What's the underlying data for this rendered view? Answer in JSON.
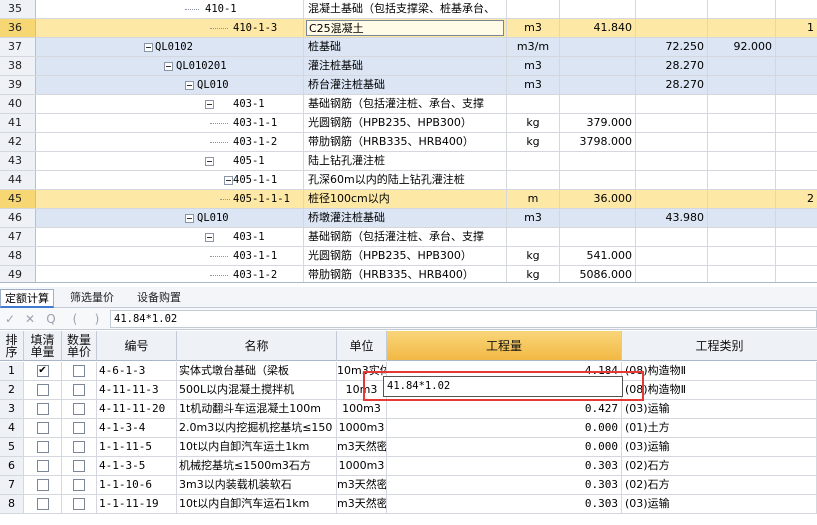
{
  "top_rows": [
    {
      "num": "35",
      "code": "410-1",
      "name": "混凝土基础（包括支撑梁、桩基承台、",
      "unit": "",
      "qty": "",
      "p1": "",
      "p2": "",
      "p3": "",
      "style": ""
    },
    {
      "num": "36",
      "code": "410-1-3",
      "name": "C25混凝土",
      "unit": "m3",
      "qty": "41.840",
      "p1": "",
      "p2": "",
      "p3": "1",
      "style": "hl"
    },
    {
      "num": "37",
      "code": "QL0102",
      "name": "桩基础",
      "unit": "m3/m",
      "qty": "",
      "p1": "72.250",
      "p2": "92.000",
      "p3": "",
      "style": "blue"
    },
    {
      "num": "38",
      "code": "QL010201",
      "name": "灌注桩基础",
      "unit": "m3",
      "qty": "",
      "p1": "28.270",
      "p2": "",
      "p3": "",
      "style": "blue"
    },
    {
      "num": "39",
      "code": "QL010",
      "name": "桥台灌注桩基础",
      "unit": "m3",
      "qty": "",
      "p1": "28.270",
      "p2": "",
      "p3": "",
      "style": "blue"
    },
    {
      "num": "40",
      "code": "403-1",
      "name": "基础钢筋（包括灌注桩、承台、支撑",
      "unit": "",
      "qty": "",
      "p1": "",
      "p2": "",
      "p3": "",
      "style": ""
    },
    {
      "num": "41",
      "code": "403-1-1",
      "name": "光圆钢筋（HPB235、HPB300）",
      "unit": "kg",
      "qty": "379.000",
      "p1": "",
      "p2": "",
      "p3": "",
      "style": ""
    },
    {
      "num": "42",
      "code": "403-1-2",
      "name": "带肋钢筋（HRB335、HRB400）",
      "unit": "kg",
      "qty": "3798.000",
      "p1": "",
      "p2": "",
      "p3": "",
      "style": ""
    },
    {
      "num": "43",
      "code": "405-1",
      "name": "陆上钻孔灌注桩",
      "unit": "",
      "qty": "",
      "p1": "",
      "p2": "",
      "p3": "",
      "style": ""
    },
    {
      "num": "44",
      "code": "405-1-1",
      "name": "孔深60m以内的陆上钻孔灌注桩",
      "unit": "",
      "qty": "",
      "p1": "",
      "p2": "",
      "p3": "",
      "style": ""
    },
    {
      "num": "45",
      "code": "405-1-1-1",
      "name": "桩径100cm以内",
      "unit": "m",
      "qty": "36.000",
      "p1": "",
      "p2": "",
      "p3": "2",
      "style": "hl"
    },
    {
      "num": "46",
      "code": "QL010",
      "name": "桥墩灌注桩基础",
      "unit": "m3",
      "qty": "",
      "p1": "43.980",
      "p2": "",
      "p3": "",
      "style": "blue"
    },
    {
      "num": "47",
      "code": "403-1",
      "name": "基础钢筋（包括灌注桩、承台、支撑",
      "unit": "",
      "qty": "",
      "p1": "",
      "p2": "",
      "p3": "",
      "style": ""
    },
    {
      "num": "48",
      "code": "403-1-1",
      "name": "光圆钢筋（HPB235、HPB300）",
      "unit": "kg",
      "qty": "541.000",
      "p1": "",
      "p2": "",
      "p3": "",
      "style": ""
    },
    {
      "num": "49",
      "code": "403-1-2",
      "name": "带肋钢筋（HRB335、HRB400）",
      "unit": "kg",
      "qty": "5086.000",
      "p1": "",
      "p2": "",
      "p3": "",
      "style": ""
    }
  ],
  "tabs": [
    "定额计算",
    "筛选量价",
    "设备购置"
  ],
  "formula": {
    "icons": [
      "✓",
      "✕",
      "Q",
      "(",
      ")"
    ],
    "value": "41.84*1.02"
  },
  "bottom_headers": {
    "num": "排序",
    "fill_price": "填清单量",
    "qty_price": "数量单价",
    "code": "编号",
    "name": "名称",
    "unit": "单位",
    "qty": "工程量",
    "type": "工程类别"
  },
  "bottom_rows": [
    {
      "num": "1",
      "c1": true,
      "c2": false,
      "code": "4-6-1-3",
      "name": "实体式墩台基础（梁板",
      "unit": "10m3实体",
      "qty": "4.184",
      "type": "(08)构造物Ⅱ"
    },
    {
      "num": "2",
      "c1": false,
      "c2": false,
      "code": "4-11-11-3",
      "name": "500L以内混凝土搅拌机",
      "unit": "10m3",
      "qty": "",
      "type": "(08)构造物Ⅱ"
    },
    {
      "num": "3",
      "c1": false,
      "c2": false,
      "code": "4-11-11-20",
      "name": "1t机动翻斗车运混凝土100m",
      "unit": "100m3",
      "qty": "0.427",
      "type": "(03)运输"
    },
    {
      "num": "4",
      "c1": false,
      "c2": false,
      "code": "4-1-3-4",
      "name": "2.0m3以内挖掘机挖基坑≤150",
      "unit": "1000m3",
      "qty": "0.000",
      "type": "(01)土方"
    },
    {
      "num": "5",
      "c1": false,
      "c2": false,
      "code": "1-1-11-5",
      "name": "10t以内自卸汽车运土1km",
      "unit": "m3天然密",
      "qty": "0.000",
      "type": "(03)运输"
    },
    {
      "num": "6",
      "c1": false,
      "c2": false,
      "code": "4-1-3-5",
      "name": "机械挖基坑≤1500m3石方",
      "unit": "1000m3",
      "qty": "0.303",
      "type": "(02)石方"
    },
    {
      "num": "7",
      "c1": false,
      "c2": false,
      "code": "1-1-10-6",
      "name": "3m3以内装载机装软石",
      "unit": "m3天然密",
      "qty": "0.303",
      "type": "(02)石方"
    },
    {
      "num": "8",
      "c1": false,
      "c2": false,
      "code": "1-1-11-19",
      "name": "10t以内自卸汽车运石1km",
      "unit": "m3天然密",
      "qty": "0.303",
      "type": "(03)运输"
    }
  ],
  "editor": {
    "value": "41.84*1.02"
  }
}
